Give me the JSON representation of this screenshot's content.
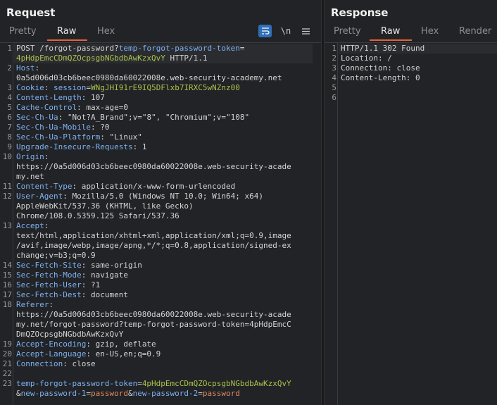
{
  "request": {
    "title": "Request",
    "tabs": [
      {
        "label": "Pretty",
        "active": false
      },
      {
        "label": "Raw",
        "active": true
      },
      {
        "label": "Hex",
        "active": false
      }
    ],
    "tools": {
      "newline_label": "\\n",
      "menu_icon": "hamburger-menu-icon",
      "wrap_icon": "word-wrap-icon"
    },
    "lines": [
      {
        "n": "1",
        "rows": [
          [
            {
              "c": "m",
              "t": "POST "
            },
            {
              "c": "v",
              "t": "/forgot-password?"
            },
            {
              "c": "k",
              "t": "temp-forgot-password-token"
            },
            {
              "c": "v",
              "t": "="
            }
          ],
          [
            {
              "c": "g",
              "t": "4pHdpEmcCDmQZOcpsgbNGbdbAwKzxQvY"
            },
            {
              "c": "v",
              "t": " HTTP/1.1"
            }
          ]
        ]
      },
      {
        "n": "2",
        "rows": [
          [
            {
              "c": "k",
              "t": "Host"
            },
            {
              "c": "v",
              "t": ":"
            }
          ],
          [
            {
              "c": "v",
              "t": "0a5d006d03cb6beec0980da60022008e.web-security-academy.net"
            }
          ]
        ]
      },
      {
        "n": "3",
        "rows": [
          [
            {
              "c": "k",
              "t": "Cookie"
            },
            {
              "c": "v",
              "t": ": "
            },
            {
              "c": "k",
              "t": "session"
            },
            {
              "c": "v",
              "t": "="
            },
            {
              "c": "g",
              "t": "WNgJHI91rE9IQ5DFlxb7IRXC5wNZnz00"
            }
          ]
        ]
      },
      {
        "n": "4",
        "rows": [
          [
            {
              "c": "k",
              "t": "Content-Length"
            },
            {
              "c": "v",
              "t": ": 107"
            }
          ]
        ]
      },
      {
        "n": "5",
        "rows": [
          [
            {
              "c": "k",
              "t": "Cache-Control"
            },
            {
              "c": "v",
              "t": ": max-age=0"
            }
          ]
        ]
      },
      {
        "n": "6",
        "rows": [
          [
            {
              "c": "k",
              "t": "Sec-Ch-Ua"
            },
            {
              "c": "v",
              "t": ": \"Not?A_Brand\";v=\"8\", \"Chromium\";v=\"108\""
            }
          ]
        ]
      },
      {
        "n": "7",
        "rows": [
          [
            {
              "c": "k",
              "t": "Sec-Ch-Ua-Mobile"
            },
            {
              "c": "v",
              "t": ": ?0"
            }
          ]
        ]
      },
      {
        "n": "8",
        "rows": [
          [
            {
              "c": "k",
              "t": "Sec-Ch-Ua-Platform"
            },
            {
              "c": "v",
              "t": ": \"Linux\""
            }
          ]
        ]
      },
      {
        "n": "9",
        "rows": [
          [
            {
              "c": "k",
              "t": "Upgrade-Insecure-Requests"
            },
            {
              "c": "v",
              "t": ": 1"
            }
          ]
        ]
      },
      {
        "n": "10",
        "rows": [
          [
            {
              "c": "k",
              "t": "Origin"
            },
            {
              "c": "v",
              "t": ":"
            }
          ],
          [
            {
              "c": "v",
              "t": "https://0a5d006d03cb6beec0980da60022008e.web-security-acade"
            }
          ],
          [
            {
              "c": "v",
              "t": "my.net"
            }
          ]
        ]
      },
      {
        "n": "11",
        "rows": [
          [
            {
              "c": "k",
              "t": "Content-Type"
            },
            {
              "c": "v",
              "t": ": application/x-www-form-urlencoded"
            }
          ]
        ]
      },
      {
        "n": "12",
        "rows": [
          [
            {
              "c": "k",
              "t": "User-Agent"
            },
            {
              "c": "v",
              "t": ": Mozilla/5.0 (Windows NT 10.0; Win64; x64)"
            }
          ],
          [
            {
              "c": "v",
              "t": "AppleWebKit/537.36 (KHTML, like Gecko)"
            }
          ],
          [
            {
              "c": "v",
              "t": "Chrome/108.0.5359.125 Safari/537.36"
            }
          ]
        ]
      },
      {
        "n": "13",
        "rows": [
          [
            {
              "c": "k",
              "t": "Accept"
            },
            {
              "c": "v",
              "t": ":"
            }
          ],
          [
            {
              "c": "v",
              "t": "text/html,application/xhtml+xml,application/xml;q=0.9,image"
            }
          ],
          [
            {
              "c": "v",
              "t": "/avif,image/webp,image/apng,*/*;q=0.8,application/signed-ex"
            }
          ],
          [
            {
              "c": "v",
              "t": "change;v=b3;q=0.9"
            }
          ]
        ]
      },
      {
        "n": "14",
        "rows": [
          [
            {
              "c": "k",
              "t": "Sec-Fetch-Site"
            },
            {
              "c": "v",
              "t": ": same-origin"
            }
          ]
        ]
      },
      {
        "n": "15",
        "rows": [
          [
            {
              "c": "k",
              "t": "Sec-Fetch-Mode"
            },
            {
              "c": "v",
              "t": ": navigate"
            }
          ]
        ]
      },
      {
        "n": "16",
        "rows": [
          [
            {
              "c": "k",
              "t": "Sec-Fetch-User"
            },
            {
              "c": "v",
              "t": ": ?1"
            }
          ]
        ]
      },
      {
        "n": "17",
        "rows": [
          [
            {
              "c": "k",
              "t": "Sec-Fetch-Dest"
            },
            {
              "c": "v",
              "t": ": document"
            }
          ]
        ]
      },
      {
        "n": "18",
        "rows": [
          [
            {
              "c": "k",
              "t": "Referer"
            },
            {
              "c": "v",
              "t": ":"
            }
          ],
          [
            {
              "c": "v",
              "t": "https://0a5d006d03cb6beec0980da60022008e.web-security-acade"
            }
          ],
          [
            {
              "c": "v",
              "t": "my.net/forgot-password?temp-forgot-password-token=4pHdpEmcC"
            }
          ],
          [
            {
              "c": "v",
              "t": "DmQZOcpsgbNGbdbAwKzxQvY"
            }
          ]
        ]
      },
      {
        "n": "19",
        "rows": [
          [
            {
              "c": "k",
              "t": "Accept-Encoding"
            },
            {
              "c": "v",
              "t": ": gzip, deflate"
            }
          ]
        ]
      },
      {
        "n": "20",
        "rows": [
          [
            {
              "c": "k",
              "t": "Accept-Language"
            },
            {
              "c": "v",
              "t": ": en-US,en;q=0.9"
            }
          ]
        ]
      },
      {
        "n": "21",
        "rows": [
          [
            {
              "c": "k",
              "t": "Connection"
            },
            {
              "c": "v",
              "t": ": close"
            }
          ]
        ]
      },
      {
        "n": "22",
        "rows": [
          [
            {
              "c": "v",
              "t": ""
            }
          ]
        ]
      },
      {
        "n": "23",
        "rows": [
          [
            {
              "c": "k",
              "t": "temp-forgot-password-token"
            },
            {
              "c": "v",
              "t": "="
            },
            {
              "c": "g",
              "t": "4pHdpEmcCDmQZOcpsgbNGbdbAwKzxQvY"
            }
          ],
          [
            {
              "c": "v",
              "t": "&"
            },
            {
              "c": "k",
              "t": "new-password-1"
            },
            {
              "c": "v",
              "t": "="
            },
            {
              "c": "o",
              "t": "password"
            },
            {
              "c": "v",
              "t": "&"
            },
            {
              "c": "k",
              "t": "new-password-2"
            },
            {
              "c": "v",
              "t": "="
            },
            {
              "c": "o",
              "t": "password"
            }
          ]
        ]
      }
    ]
  },
  "response": {
    "title": "Response",
    "tabs": [
      {
        "label": "Pretty",
        "active": false
      },
      {
        "label": "Raw",
        "active": true
      },
      {
        "label": "Hex",
        "active": false
      },
      {
        "label": "Render",
        "active": false
      }
    ],
    "lines": [
      {
        "n": "1",
        "rows": [
          [
            {
              "c": "v",
              "t": "HTTP/1.1 302 Found"
            }
          ]
        ]
      },
      {
        "n": "2",
        "rows": [
          [
            {
              "c": "v",
              "t": "Location: /"
            }
          ]
        ]
      },
      {
        "n": "3",
        "rows": [
          [
            {
              "c": "v",
              "t": "Connection: close"
            }
          ]
        ]
      },
      {
        "n": "4",
        "rows": [
          [
            {
              "c": "v",
              "t": "Content-Length: 0"
            }
          ]
        ]
      },
      {
        "n": "5",
        "rows": [
          [
            {
              "c": "v",
              "t": ""
            }
          ]
        ]
      },
      {
        "n": "6",
        "rows": [
          [
            {
              "c": "v",
              "t": ""
            }
          ]
        ]
      }
    ]
  },
  "colors": {
    "accent": "#e2643c",
    "header_key": "#7db1f0",
    "value_green": "#a7c34b",
    "value_orange": "#e08a5f",
    "wrap_button": "#2f6fb8"
  }
}
